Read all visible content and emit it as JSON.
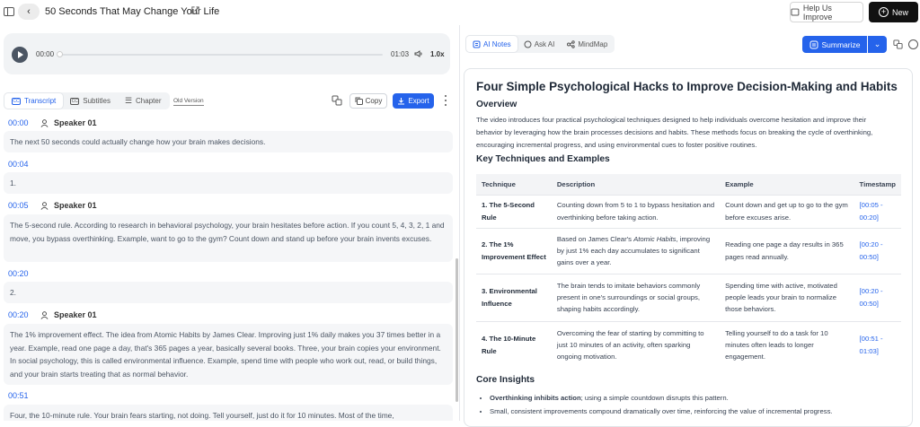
{
  "header": {
    "title": "50 Seconds That May Change Your Life",
    "help_label": "Help Us Improve",
    "new_label": "New"
  },
  "player": {
    "current_time": "00:00",
    "duration": "01:03",
    "speed": "1.0x",
    "progress": 0
  },
  "left_tabs": [
    {
      "label": "Transcript",
      "active": true
    },
    {
      "label": "Subtitles",
      "active": false
    },
    {
      "label": "Chapter",
      "active": false
    }
  ],
  "old_version_label": "Old Version",
  "copy_label": "Copy",
  "export_label": "Export",
  "transcript": [
    {
      "time": "00:00",
      "speaker": "Speaker 01",
      "text": "The next 50 seconds could actually change how your brain makes decisions."
    },
    {
      "time": "00:04",
      "speaker": "",
      "text": "1."
    },
    {
      "time": "00:05",
      "speaker": "Speaker 01",
      "text": "The 5-second rule. According to research in behavioral psychology, your brain hesitates before action. If you count 5, 4, 3, 2, 1 and move, you bypass overthinking. Example, want to go to the gym? Count down and stand up before your brain invents excuses."
    },
    {
      "time": "00:20",
      "speaker": "",
      "text": "2."
    },
    {
      "time": "00:20",
      "speaker": "Speaker 01",
      "text": "The 1% improvement effect. The idea from Atomic Habits by James Clear. Improving just 1% daily makes you 37 times better in a year. Example, read one page a day, that's 365 pages a year, basically several books. Three, your brain copies your environment. In social psychology, this is called environmental influence. Example, spend time with people who work out, read, or build things, and your brain starts treating that as normal behavior."
    },
    {
      "time": "00:51",
      "speaker": "",
      "text": "Four, the 10-minute rule. Your brain fears starting, not doing. Tell yourself, just do it for 10 minutes. Most of the time,"
    }
  ],
  "right_tabs": [
    {
      "label": "AI Notes",
      "active": true
    },
    {
      "label": "Ask AI",
      "active": false
    },
    {
      "label": "MindMap",
      "active": false
    }
  ],
  "summarize_label": "Summarize",
  "notes": {
    "title": "Four Simple Psychological Hacks to Improve Decision-Making and Habits",
    "overview_heading": "Overview",
    "overview_text": "The video introduces four practical psychological techniques designed to help individuals overcome hesitation and improve their behavior by leveraging how the brain processes decisions and habits. These methods focus on breaking the cycle of overthinking, encouraging incremental progress, and using environmental cues to foster positive routines.",
    "key_heading": "Key Techniques and Examples",
    "table_headers": [
      "Technique",
      "Description",
      "Example",
      "Timestamp"
    ],
    "table_rows": [
      {
        "technique": "1. The 5-Second Rule",
        "description": "Counting down from 5 to 1 to bypass hesitation and overthinking before taking action.",
        "example": "Count down and get up to go to the gym before excuses arise.",
        "timestamp": "[00:05 - 00:20]"
      },
      {
        "technique": "2. The 1% Improvement Effect",
        "description_pre": "Based on James Clear's ",
        "description_em": "Atomic Habits",
        "description_post": ", improving by just 1% each day accumulates to significant gains over a year.",
        "example": "Reading one page a day results in 365 pages read annually.",
        "timestamp": "[00:20 - 00:50]"
      },
      {
        "technique": "3. Environmental Influence",
        "description": "The brain tends to imitate behaviors commonly present in one's surroundings or social groups, shaping habits accordingly.",
        "example": "Spending time with active, motivated people leads your brain to normalize those behaviors.",
        "timestamp": "[00:20 - 00:50]"
      },
      {
        "technique": "4. The 10-Minute Rule",
        "description": "Overcoming the fear of starting by committing to just 10 minutes of an activity, often sparking ongoing motivation.",
        "example": "Telling yourself to do a task for 10 minutes often leads to longer engagement.",
        "timestamp": "[00:51 - 01:03]"
      }
    ],
    "insights_heading": "Core Insights",
    "insights": [
      {
        "bold": "Overthinking inhibits action",
        "rest": "; using a simple countdown disrupts this pattern."
      },
      {
        "bold": "",
        "rest": "Small, consistent improvements compound dramatically over time, reinforcing the value of incremental progress."
      }
    ]
  },
  "colors": {
    "accent": "#2563eb",
    "dark": "#111111",
    "panel": "#f1f3f5"
  }
}
